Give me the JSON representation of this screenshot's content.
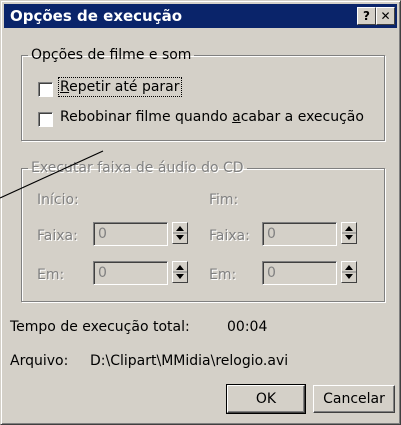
{
  "window": {
    "title": "Opções de execução",
    "help_glyph": "?",
    "close_glyph": "✕"
  },
  "movie_group": {
    "legend": "Opções de filme e som",
    "repeat": {
      "mnemonic": "R",
      "label_rest": "epetir até parar",
      "checked": false
    },
    "rewind": {
      "label_before": "Rebobinar filme quando ",
      "mnemonic": "a",
      "label_after": "cabar a execução",
      "checked": false
    }
  },
  "cd_group": {
    "legend": "Executar faixa de áudio do CD",
    "start_header": "Início:",
    "end_header": "Fim:",
    "start_track_label": "Faixa:",
    "start_track_value": "0",
    "start_at_label": "Em:",
    "start_at_value": "0",
    "end_track_label": "Faixa:",
    "end_track_value": "0",
    "end_at_label": "Em:",
    "end_at_value": "0"
  },
  "info": {
    "total_time_label": "Tempo de execução total:",
    "total_time_value": "00:04",
    "file_label": "Arquivo:",
    "file_path": "D:\\Clipart\\MMidia\\relogio.avi"
  },
  "buttons": {
    "ok": "OK",
    "cancel": "Cancelar"
  }
}
